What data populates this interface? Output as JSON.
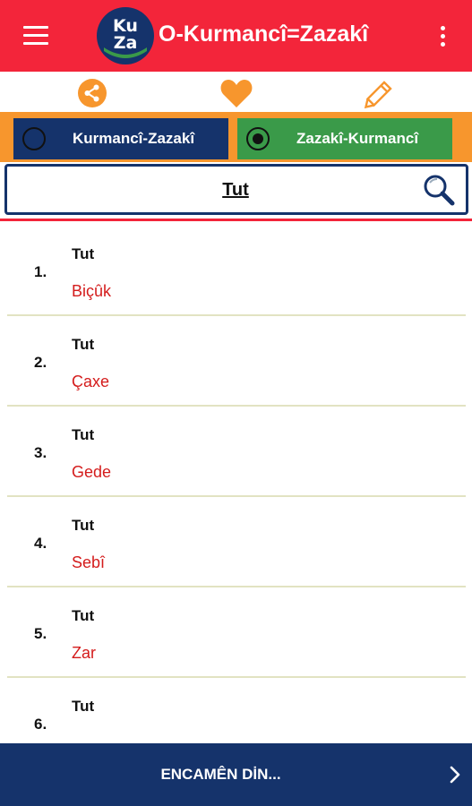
{
  "appbar": {
    "title": "O-Kurmancî=Zazakî",
    "logo_line1": "Ku",
    "logo_line2": "Za",
    "icons": [
      "menu-icon",
      "overflow-menu-icon"
    ]
  },
  "actions": {
    "icons": [
      "share-icon",
      "heart-icon",
      "pencil-icon"
    ]
  },
  "direction": {
    "left_label": "Kurmancî-Zazakî",
    "right_label": "Zazakî-Kurmancî",
    "selected": "Zazakî-Kurmancî"
  },
  "search": {
    "value": "Tut"
  },
  "results": [
    {
      "num": "1.",
      "source": "Tut",
      "target": "Biçûk"
    },
    {
      "num": "2.",
      "source": "Tut",
      "target": "Çaxe"
    },
    {
      "num": "3.",
      "source": "Tut",
      "target": "Gede"
    },
    {
      "num": "4.",
      "source": "Tut",
      "target": "Sebî"
    },
    {
      "num": "5.",
      "source": "Tut",
      "target": "Zar"
    },
    {
      "num": "6.",
      "source": "Tut",
      "target": ""
    }
  ],
  "bottom": {
    "label": "ENCAMÊN DİN..."
  },
  "colors": {
    "appbar": "#f3253a",
    "orange": "#f7962d",
    "navy": "#15336b",
    "green": "#3a9a49",
    "translation": "#d41c1c"
  }
}
